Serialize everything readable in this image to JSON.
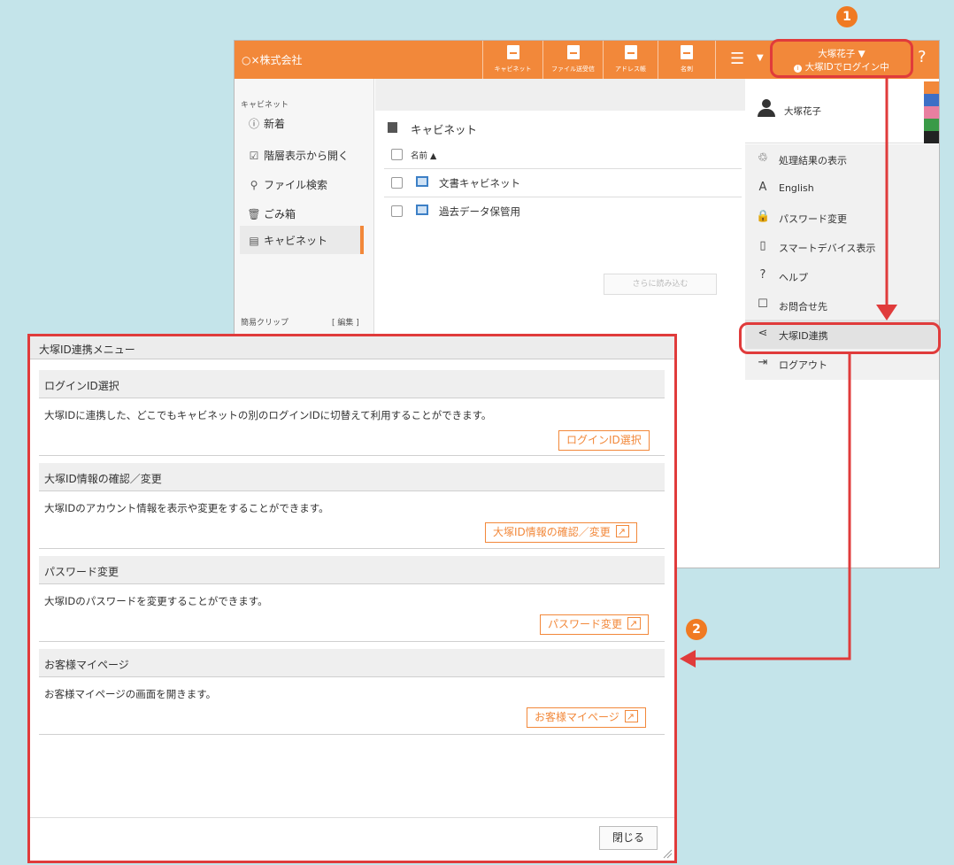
{
  "header": {
    "company": "○×株式会社",
    "buttons": [
      {
        "label": "キャビネット",
        "icon": "cabinet-icon"
      },
      {
        "label": "ファイル送受信",
        "icon": "file-transfer-icon"
      },
      {
        "label": "アドレス帳",
        "icon": "address-book-icon"
      },
      {
        "label": "名刺",
        "icon": "business-card-icon"
      }
    ],
    "menu_icon": "hamburger-icon",
    "user_name": "大塚花子 ▼",
    "user_status": "大塚IDでログイン中",
    "help": "?"
  },
  "sidebar": {
    "heading": "キャビネット",
    "items": [
      {
        "label": "新着",
        "icon": "new-icon"
      },
      {
        "label": "階層表示から開く",
        "icon": "tree-icon"
      },
      {
        "label": "ファイル検索",
        "icon": "search-icon"
      },
      {
        "label": "ごみ箱",
        "icon": "trash-icon"
      },
      {
        "label": "キャビネット",
        "icon": "cabinet-icon"
      }
    ],
    "clip_label": "簡易クリップ",
    "clip_edit": "[ 編集 ]"
  },
  "content": {
    "title": "キャビネット",
    "column_header": "名前 ▲",
    "rows": [
      {
        "name": "文書キャビネット"
      },
      {
        "name": "過去データ保管用"
      }
    ],
    "load_more": "さらに読み込む"
  },
  "user_menu": {
    "user_name": "大塚花子",
    "swatches": [
      "#f2883a",
      "#3d6fc6",
      "#e97fa0",
      "#3a9a47",
      "#222222"
    ],
    "items": [
      {
        "label": "処理結果の表示",
        "icon": "result-icon",
        "glyph": "♲"
      },
      {
        "label": "English",
        "icon": "language-icon",
        "glyph": "A"
      },
      {
        "label": "パスワード変更",
        "icon": "lock-icon",
        "glyph": "🔒"
      },
      {
        "label": "スマートデバイス表示",
        "icon": "smartphone-icon",
        "glyph": "▯"
      },
      {
        "label": "ヘルプ",
        "icon": "help-icon",
        "glyph": "?"
      },
      {
        "label": "お問合せ先",
        "icon": "contact-icon",
        "glyph": "☐"
      },
      {
        "label": "大塚ID連携",
        "icon": "share-icon",
        "glyph": "⋖"
      },
      {
        "label": "ログアウト",
        "icon": "logout-icon",
        "glyph": "⇥"
      }
    ]
  },
  "dialog": {
    "title": "大塚ID連携メニュー",
    "sections": [
      {
        "heading": "ログインID選択",
        "description": "大塚IDに連携した、どこでもキャビネットの別のログインIDに切替えて利用することができます。",
        "button": "ログインID選択",
        "external": false
      },
      {
        "heading": "大塚ID情報の確認／変更",
        "description": "大塚IDのアカウント情報を表示や変更をすることができます。",
        "button": "大塚ID情報の確認／変更",
        "external": true
      },
      {
        "heading": "パスワード変更",
        "description": "大塚IDのパスワードを変更することができます。",
        "button": "パスワード変更",
        "external": true
      },
      {
        "heading": "お客様マイページ",
        "description": "お客様マイページの画面を開きます。",
        "button": "お客様マイページ",
        "external": true
      }
    ],
    "close": "閉じる"
  },
  "annotations": {
    "step1": "1",
    "step2": "2",
    "color": "#e03b3b"
  }
}
